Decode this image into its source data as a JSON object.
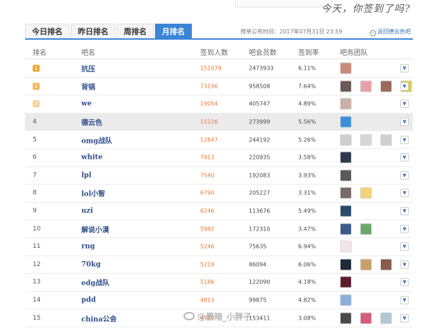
{
  "slogan": "今天，你签到了吗?",
  "tabs": [
    {
      "label": "今日排名"
    },
    {
      "label": "昨日排名"
    },
    {
      "label": "周排名"
    },
    {
      "label": "月排名",
      "active": true
    }
  ],
  "updated_text": "榜单公布时间：2017年07月31日 23:59",
  "back_link": "返回德云色吧",
  "columns": [
    "排名",
    "吧名",
    "签到人数",
    "吧会员数",
    "签到率",
    "吧务团队"
  ],
  "medal_colors": [
    "#f2a93b",
    "#f5b562",
    "#f7cf93"
  ],
  "rows": [
    {
      "rank": "1",
      "name": "抗压",
      "signed": "151079",
      "members": "2473933",
      "rate": "6.11%",
      "team": [
        "#c98b7a"
      ]
    },
    {
      "rank": "2",
      "name": "背锅",
      "signed": "73196",
      "members": "958508",
      "rate": "7.64%",
      "team": [
        "#6a5a55",
        "#e8a0a8",
        "#9a6a5a",
        "#d8d04a"
      ]
    },
    {
      "rank": "3",
      "name": "we",
      "signed": "19054",
      "members": "405747",
      "rate": "4.89%",
      "team": [
        "#c9b1a8"
      ]
    },
    {
      "rank": "4",
      "name": "德云色",
      "signed": "15226",
      "members": "273999",
      "rate": "5.56%",
      "team": [
        "#3a8fd8"
      ],
      "highlight": true
    },
    {
      "rank": "5",
      "name": "omg战队",
      "signed": "12847",
      "members": "244192",
      "rate": "5.26%",
      "team": [
        "#cfcfcf",
        "#d6d6d6",
        "#d0d0d0"
      ]
    },
    {
      "rank": "6",
      "name": "white",
      "signed": "7913",
      "members": "220935",
      "rate": "3.58%",
      "team": [
        "#2d3a4d"
      ]
    },
    {
      "rank": "7",
      "name": "lpl",
      "signed": "7540",
      "members": "192083",
      "rate": "3.93%",
      "team": [
        "#5a5a5a"
      ]
    },
    {
      "rank": "8",
      "name": "lol小智",
      "signed": "6790",
      "members": "205227",
      "rate": "3.31%",
      "team": [
        "#7a6a6a",
        "#f3d37a"
      ]
    },
    {
      "rank": "9",
      "name": "uzi",
      "signed": "6246",
      "members": "113676",
      "rate": "5.49%",
      "team": [
        "#2a4a6a"
      ]
    },
    {
      "rank": "10",
      "name": "解说小漠",
      "signed": "5982",
      "members": "172310",
      "rate": "3.47%",
      "team": [
        "#3d5a8a",
        "#6aa86a"
      ]
    },
    {
      "rank": "11",
      "name": "rng",
      "signed": "5246",
      "members": "75635",
      "rate": "6.94%",
      "team": [
        "#f3e6e6"
      ]
    },
    {
      "rank": "12",
      "name": "70kg",
      "signed": "5219",
      "members": "86094",
      "rate": "6.06%",
      "team": [
        "#1f2a3a",
        "#c9a06a",
        "#8a5a4a"
      ]
    },
    {
      "rank": "13",
      "name": "edg战队",
      "signed": "5186",
      "members": "122090",
      "rate": "4.18%",
      "team": [
        "#5a1f2a"
      ]
    },
    {
      "rank": "14",
      "name": "pdd",
      "signed": "4813",
      "members": "99875",
      "rate": "4.82%",
      "team": [
        "#8ab0d8"
      ]
    },
    {
      "rank": "15",
      "name": "china公会",
      "signed": "4727",
      "members": "153411",
      "rate": "3.08%",
      "team": [
        "#4a4a4a",
        "#d85a7a",
        "#b0c8d8"
      ]
    }
  ],
  "watermark": "@黑暗_小胖子"
}
